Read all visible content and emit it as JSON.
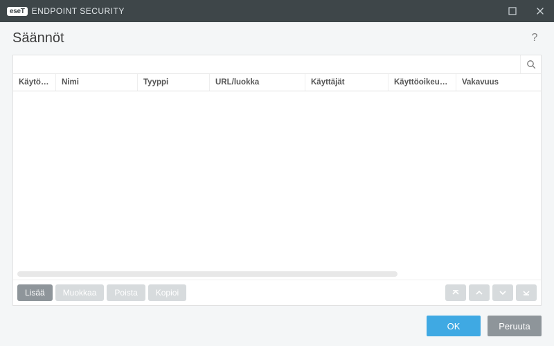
{
  "brand": {
    "badge": "eseT",
    "product": "ENDPOINT SECURITY"
  },
  "dialog": {
    "title": "Säännöt"
  },
  "search": {
    "value": "",
    "placeholder": ""
  },
  "columns": {
    "enabled": "Käytössä",
    "name": "Nimi",
    "type": "Tyyppi",
    "url": "URL/luokka",
    "users": "Käyttäjät",
    "rights": "Käyttöoikeudet",
    "severity": "Vakavuus"
  },
  "actions": {
    "add": "Lisää",
    "edit": "Muokkaa",
    "delete": "Poista",
    "copy": "Kopioi"
  },
  "footer": {
    "ok": "OK",
    "cancel": "Peruuta"
  }
}
